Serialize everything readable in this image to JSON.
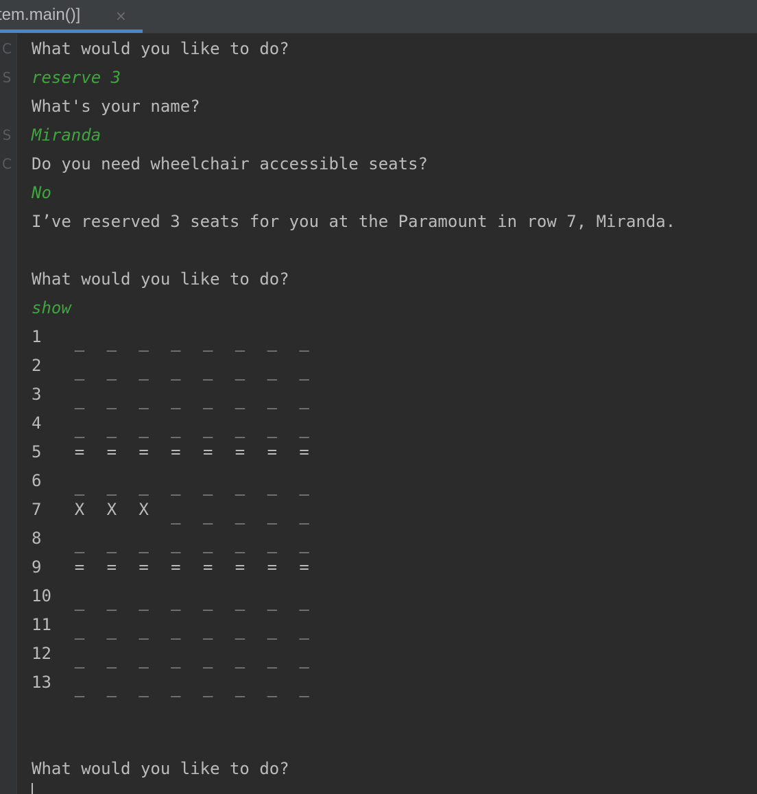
{
  "tab": {
    "title": "stem.main()]",
    "close_glyph": "×"
  },
  "gutter_marks": [
    "C",
    "S",
    "S",
    "C"
  ],
  "transcript": [
    {
      "text": "What would you like to do?",
      "input": false
    },
    {
      "text": "reserve 3",
      "input": true
    },
    {
      "text": "What's your name?",
      "input": false
    },
    {
      "text": "Miranda",
      "input": true
    },
    {
      "text": "Do you need wheelchair accessible seats?",
      "input": false
    },
    {
      "text": "No",
      "input": true
    },
    {
      "text": "I’ve reserved 3 seats for you at the Paramount in row 7, Miranda.",
      "input": false
    },
    {
      "text": "",
      "input": false
    },
    {
      "text": "What would you like to do?",
      "input": false
    },
    {
      "text": "show",
      "input": true
    }
  ],
  "seating_chart": [
    {
      "row": "1",
      "seats": [
        "_",
        "_",
        "_",
        "_",
        "_",
        "_",
        "_",
        "_"
      ]
    },
    {
      "row": "2",
      "seats": [
        "_",
        "_",
        "_",
        "_",
        "_",
        "_",
        "_",
        "_"
      ]
    },
    {
      "row": "3",
      "seats": [
        "_",
        "_",
        "_",
        "_",
        "_",
        "_",
        "_",
        "_"
      ]
    },
    {
      "row": "4",
      "seats": [
        "_",
        "_",
        "_",
        "_",
        "_",
        "_",
        "_",
        "_"
      ]
    },
    {
      "row": "5",
      "seats": [
        "=",
        "=",
        "=",
        "=",
        "=",
        "=",
        "=",
        "="
      ]
    },
    {
      "row": "6",
      "seats": [
        "_",
        "_",
        "_",
        "_",
        "_",
        "_",
        "_",
        "_"
      ]
    },
    {
      "row": "7",
      "seats": [
        "X",
        "X",
        "X",
        "_",
        "_",
        "_",
        "_",
        "_"
      ]
    },
    {
      "row": "8",
      "seats": [
        "_",
        "_",
        "_",
        "_",
        "_",
        "_",
        "_",
        "_"
      ]
    },
    {
      "row": "9",
      "seats": [
        "=",
        "=",
        "=",
        "=",
        "=",
        "=",
        "=",
        "="
      ]
    },
    {
      "row": "10",
      "seats": [
        "_",
        "_",
        "_",
        "_",
        "_",
        "_",
        "_",
        "_"
      ]
    },
    {
      "row": "11",
      "seats": [
        "_",
        "_",
        "_",
        "_",
        "_",
        "_",
        "_",
        "_"
      ]
    },
    {
      "row": "12",
      "seats": [
        "_",
        "_",
        "_",
        "_",
        "_",
        "_",
        "_",
        "_"
      ]
    },
    {
      "row": "13",
      "seats": [
        "_",
        "_",
        "_",
        "_",
        "_",
        "_",
        "_",
        "_"
      ]
    }
  ],
  "final_prompt": "What would you like to do?",
  "colors": {
    "background": "#2b2b2b",
    "text": "#bbbbbb",
    "user_input": "#3fa53f",
    "tab_accent": "#4a88c7"
  }
}
